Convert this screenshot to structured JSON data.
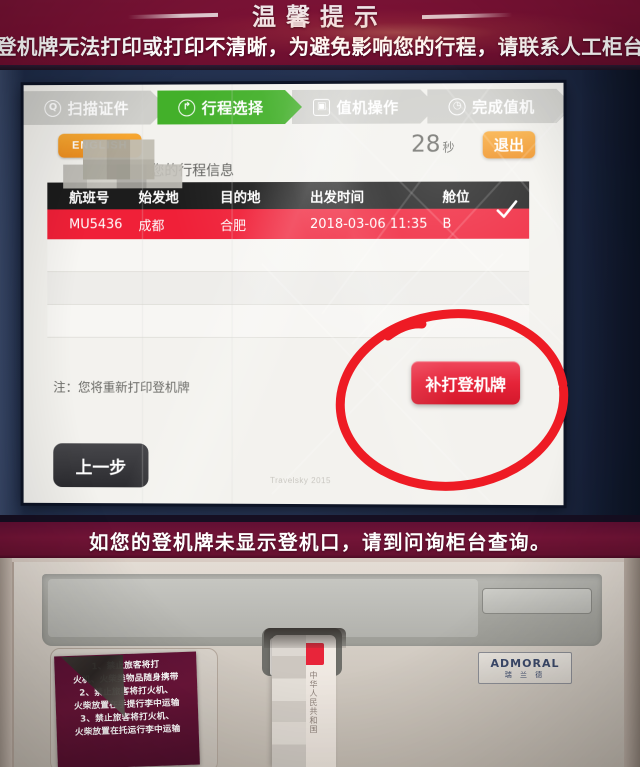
{
  "top_banner": {
    "title": "温馨提示",
    "message": "登机牌无法打印或打印不清晰，为避免影响您的行程，请联系人工柜台!"
  },
  "bottom_banner": {
    "message": "如您的登机牌未显示登机口，请到问询柜台查询。"
  },
  "kiosk_screen": {
    "nav_steps": [
      {
        "label": "扫描证件",
        "icon": "scan-id-icon",
        "icon_glyph": "Q",
        "active": false
      },
      {
        "label": "行程选择",
        "icon": "itinerary-icon",
        "icon_glyph": "↱",
        "active": true
      },
      {
        "label": "值机操作",
        "icon": "checkin-icon",
        "icon_glyph": "▣",
        "active": false
      },
      {
        "label": "完成值机",
        "icon": "complete-icon",
        "icon_glyph": "◷",
        "active": false
      }
    ],
    "language_button": "ENGLISH",
    "timer": {
      "value": "28",
      "unit": "秒"
    },
    "exit_button": "退出",
    "section_title": "您的行程信息",
    "table": {
      "headers": [
        "航班号",
        "始发地",
        "目的地",
        "出发时间",
        "舱位"
      ],
      "rows": [
        {
          "flight_no": "MU5436",
          "origin": "成都",
          "destination": "合肥",
          "departure_time": "2018-03-06 11:35",
          "cabin": "B",
          "selected": true
        }
      ]
    },
    "note": "注：您将重新打印登机牌",
    "reprint_button": "补打登机牌",
    "back_button": "上一步",
    "watermark": "Travelsky 2015",
    "colors": {
      "active_step": "#43b02a",
      "inactive_step": "#cfcfcb",
      "row_selected": "#f02038",
      "accent_orange": "#ef8f1e",
      "reprint_red": "#e52338",
      "annotation_red": "#ee1b24"
    }
  },
  "lower_panel": {
    "warning_sticker": [
      "1、禁止旅客将打",
      "火机、火柴类物品随身携带",
      "2、禁止旅客将打火机、",
      "火柴放置在手提行李中运输",
      "3、禁止旅客将打火机、",
      "火柴放置在托运行李中运输"
    ],
    "brand_plate": {
      "name": "ADMORAL",
      "subtitle": "瑞 兰 德"
    },
    "inserted_card": {
      "text": "中华人民共和国"
    }
  }
}
